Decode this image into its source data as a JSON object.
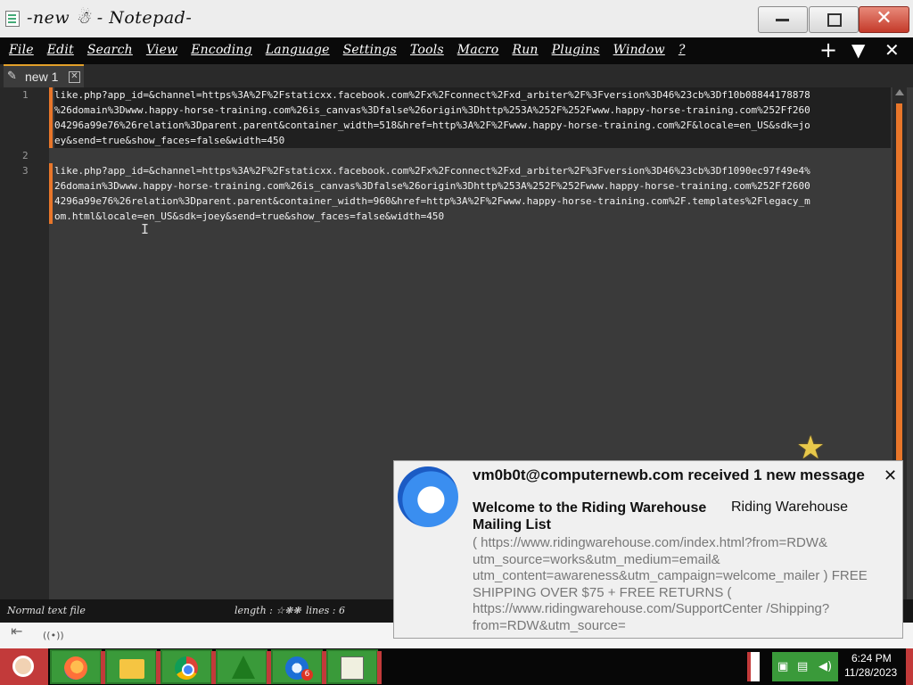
{
  "window": {
    "title": "-new ☃ - Notepad-",
    "controls": {
      "minimize": "minimize",
      "maximize": "maximize",
      "close": "✕"
    }
  },
  "menubar": {
    "items": [
      "File",
      "Edit",
      "Search",
      "View",
      "Encoding",
      "Language",
      "Settings",
      "Tools",
      "Macro",
      "Run",
      "Plugins",
      "Window",
      "?"
    ],
    "icons": {
      "plus": "+",
      "dropdown": "▼",
      "close": "✕"
    }
  },
  "tabs": [
    {
      "label": "new 1",
      "close": "✕",
      "icon": "pencil-icon"
    }
  ],
  "editor": {
    "line_numbers": [
      "1",
      "2",
      "3"
    ],
    "line1": "like.php?app_id=&channel=https%3A%2F%2Fstaticxx.facebook.com%2Fx%2Fconnect%2Fxd_arbiter%2F%3Fversion%3D46%23cb%3Df10b08844178878\n%26domain%3Dwww.happy-horse-training.com%26is_canvas%3Dfalse%26origin%3Dhttp%253A%252F%252Fwww.happy-horse-training.com%252Ff260\n04296a99e76%26relation%3Dparent.parent&container_width=518&href=http%3A%2F%2Fwww.happy-horse-training.com%2F&locale=en_US&sdk=jo\ney&send=true&show_faces=false&width=450",
    "line3": "like.php?app_id=&channel=https%3A%2F%2Fstaticxx.facebook.com%2Fx%2Fconnect%2Fxd_arbiter%2F%3Fversion%3D46%23cb%3Df1090ec97f49e4%\n26domain%3Dwww.happy-horse-training.com%26is_canvas%3Dfalse%26origin%3Dhttp%253A%252F%252Fwww.happy-horse-training.com%252Ff2600\n4296a99e76%26relation%3Dparent.parent&container_width=960&href=http%3A%2F%2Fwww.happy-horse-training.com%2F.templates%2Flegacy_m\nom.html&locale=en_US&sdk=joey&send=true&show_faces=false&width=450"
  },
  "statusbar": {
    "file_type": "Normal text file",
    "length": "length : ☆❋❋",
    "lines": "lines : 6"
  },
  "notification": {
    "header": "vm0b0t@computernewb.com received 1 new message",
    "subject": "Welcome to the Riding Warehouse Mailing List",
    "sender": "Riding Warehouse",
    "body": "( https://www.ridingwarehouse.com/index.html?from=RDW& utm_source=works&utm_medium=email& utm_content=awareness&utm_campaign=welcome_mailer ) FREE SHIPPING OVER $75 + FREE RETURNS ( https://www.ridingwarehouse.com/SupportCenter /Shipping?from=RDW&utm_source=",
    "close": "✕",
    "logo": "thunderbird-icon"
  },
  "taskbar": {
    "apps": [
      "firefox-icon",
      "file-explorer-icon",
      "chrome-icon",
      "christmas-tree-icon",
      "thunderbird-icon",
      "chart-app-icon"
    ],
    "thunderbird_badge": "6",
    "clock_time": "6:24 PM",
    "clock_date": "11/28/2023"
  },
  "colors": {
    "accent": "#e8762a",
    "taskbar_green": "#3a9a3a",
    "taskbar_red": "#c23a3a"
  }
}
